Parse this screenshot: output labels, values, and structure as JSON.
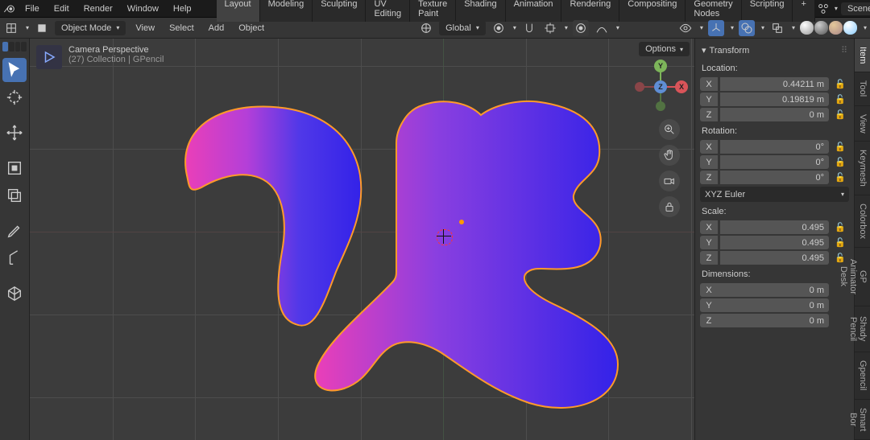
{
  "menu": {
    "file": "File",
    "edit": "Edit",
    "render": "Render",
    "window": "Window",
    "help": "Help"
  },
  "tabs": [
    "Layout",
    "Modeling",
    "Sculpting",
    "UV Editing",
    "Texture Paint",
    "Shading",
    "Animation",
    "Rendering",
    "Compositing",
    "Geometry Nodes",
    "Scripting"
  ],
  "active_tab": 0,
  "scene_label": "Scene",
  "secbar": {
    "mode": "Object Mode",
    "view": "View",
    "select": "Select",
    "add": "Add",
    "object": "Object",
    "orient": "Global",
    "options": "Options"
  },
  "info": {
    "line1": "Camera Perspective",
    "line2": "(27) Collection | GPencil"
  },
  "gizmo": {
    "x": "X",
    "y": "Y",
    "z": "Z"
  },
  "panel": {
    "title": "Transform",
    "location_lbl": "Location:",
    "rotation_lbl": "Rotation:",
    "scale_lbl": "Scale:",
    "dimensions_lbl": "Dimensions:",
    "rot_mode": "XYZ Euler",
    "loc": [
      {
        "a": "X",
        "v": "0.44211 m"
      },
      {
        "a": "Y",
        "v": "0.19819 m"
      },
      {
        "a": "Z",
        "v": "0 m"
      }
    ],
    "rot": [
      {
        "a": "X",
        "v": "0°"
      },
      {
        "a": "Y",
        "v": "0°"
      },
      {
        "a": "Z",
        "v": "0°"
      }
    ],
    "scl": [
      {
        "a": "X",
        "v": "0.495"
      },
      {
        "a": "Y",
        "v": "0.495"
      },
      {
        "a": "Z",
        "v": "0.495"
      }
    ],
    "dim": [
      {
        "a": "X",
        "v": "0 m"
      },
      {
        "a": "Y",
        "v": "0 m"
      },
      {
        "a": "Z",
        "v": "0 m"
      }
    ]
  },
  "vtabs": [
    "Item",
    "Tool",
    "View",
    "Keymesh",
    "Colorbox",
    "GP Animator Desk",
    "Shady Pencil",
    "Gpencil",
    "Smart Bor"
  ],
  "active_vtab": 0
}
